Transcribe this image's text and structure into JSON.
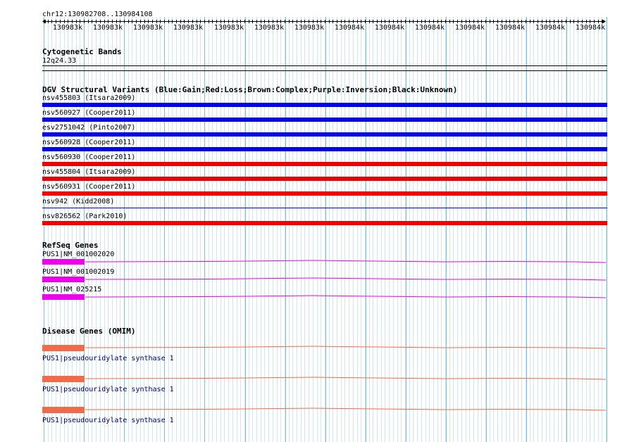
{
  "location": "chr12:130982708..130984108",
  "ruler": {
    "tick_labels": [
      "130983k",
      "130983k",
      "130983k",
      "130983k",
      "130983k",
      "130983k",
      "130983k",
      "130984k",
      "130984k",
      "130984k",
      "130984k",
      "130984k",
      "130984k",
      "130984k"
    ]
  },
  "cytoband": {
    "title": "Cytogenetic Bands",
    "band": "12q24.33"
  },
  "dgv": {
    "title": "DGV Structural Variants (Blue:Gain;Red:Loss;Brown:Complex;Purple:Inversion;Black:Unknown)",
    "variants": [
      {
        "label": "nsv455803 (Itsara2009)",
        "color": "#0000ee",
        "thick": true
      },
      {
        "label": "nsv560927 (Cooper2011)",
        "color": "#0000ee",
        "thick": true
      },
      {
        "label": "esv2751042 (Pinto2007)",
        "color": "#0000ee",
        "thick": true
      },
      {
        "label": "nsv560928 (Cooper2011)",
        "color": "#0000ee",
        "thick": true
      },
      {
        "label": "nsv560930 (Cooper2011)",
        "color": "#ee0000",
        "thick": true
      },
      {
        "label": "nsv455804 (Itsara2009)",
        "color": "#ee0000",
        "thick": true
      },
      {
        "label": "nsv560931 (Cooper2011)",
        "color": "#ee0000",
        "thick": true
      },
      {
        "label": "nsv942 (Kidd2008)",
        "color": "#0000ee",
        "thick": false
      },
      {
        "label": "nsv826562 (Park2010)",
        "color": "#ee0000",
        "thick": true
      }
    ]
  },
  "refseq": {
    "title": "RefSeq Genes",
    "genes": [
      {
        "label": "PUS1|NM_001002020",
        "color": "#ee00ee"
      },
      {
        "label": "PUS1|NM_001002019",
        "color": "#ee00ee"
      },
      {
        "label": "PUS1|NM_025215",
        "color": "#ee00ee"
      }
    ]
  },
  "omim": {
    "title": "Disease Genes (OMIM)",
    "genes": [
      {
        "label": "PUS1|pseudouridylate synthase 1",
        "color": "#f26a4a"
      },
      {
        "label": "PUS1|pseudouridylate synthase 1",
        "color": "#f26a4a"
      },
      {
        "label": "PUS1|pseudouridylate synthase 1",
        "color": "#f26a4a"
      }
    ]
  },
  "colors": {
    "grid_minor": "#cfe6ee",
    "grid_major": "#7fc0d6"
  }
}
